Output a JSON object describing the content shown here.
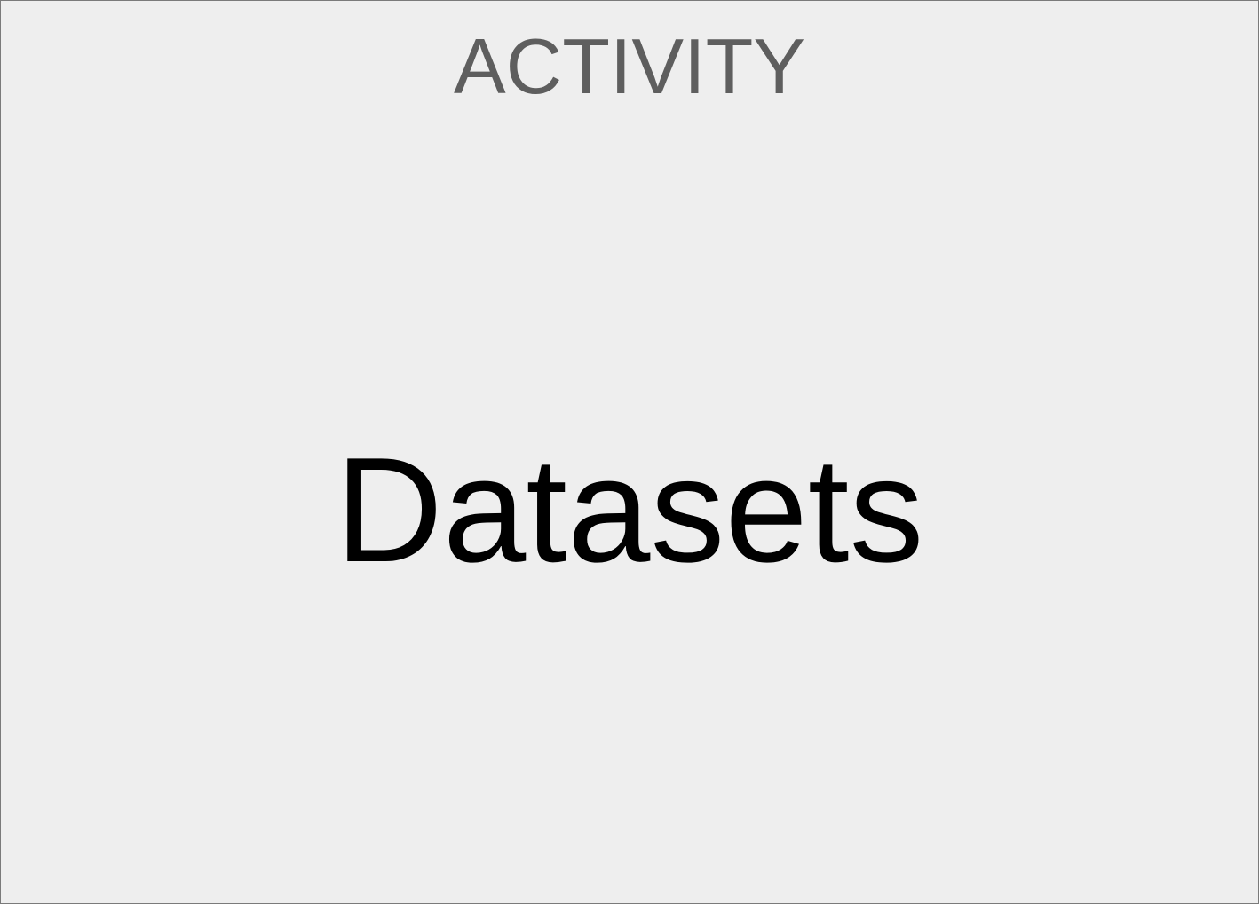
{
  "card": {
    "label": "ACTIVITY",
    "title": "Datasets"
  },
  "colors": {
    "background": "#eeeeee",
    "border": "#7a7a7a",
    "label": "#5e5e5e",
    "title": "#000000"
  }
}
